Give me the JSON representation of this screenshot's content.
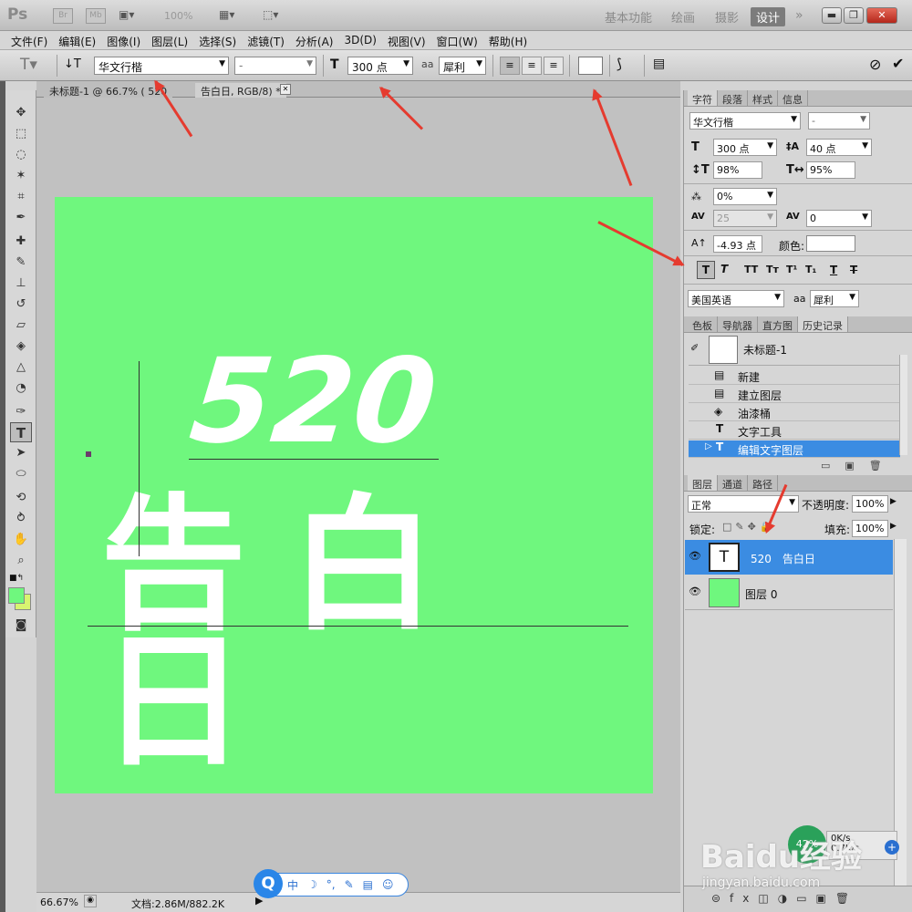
{
  "app": {
    "logo": "Ps",
    "mini_br": "Br",
    "mini_mb": "Mb",
    "zoom_pct": "100%",
    "workspaces": [
      "基本功能",
      "绘画",
      "摄影",
      "设计"
    ],
    "more": "»"
  },
  "menu": [
    "文件(F)",
    "编辑(E)",
    "图像(I)",
    "图层(L)",
    "选择(S)",
    "滤镜(T)",
    "分析(A)",
    "3D(D)",
    "视图(V)",
    "窗口(W)",
    "帮助(H)"
  ],
  "options": {
    "font_family": "华文行楷",
    "font_style": "-",
    "font_size": "300 点",
    "aa_label": "a",
    "aa_mode": "犀利"
  },
  "doc": {
    "tab1": "未标题-1 @ 66.7% ( 520",
    "tab2": "告白日, RGB/8) *",
    "close": "✕"
  },
  "canvas": {
    "line1": "520",
    "line2": "告白日",
    "bg": "#6ff77e"
  },
  "status": {
    "zoom": "66.67%",
    "doc_info": "文档:2.86M/882.2K"
  },
  "ime": {
    "items": [
      "中",
      "☽",
      "°,",
      "✎",
      "▤",
      "☺"
    ]
  },
  "char_panel": {
    "tabs": [
      "字符",
      "段落",
      "样式",
      "信息"
    ],
    "font_family": "华文行楷",
    "font_style": "-",
    "size": "300 点",
    "leading": "40 点",
    "vscale": "98%",
    "hscale": "95%",
    "tsume": "0%",
    "kerning": "25",
    "tracking": "0",
    "baseline": "-4.93 点",
    "color_label": "颜色:",
    "language": "美国英语",
    "aa_label": "a",
    "aa_mode": "犀利"
  },
  "hist_panel": {
    "tabs": [
      "色板",
      "导航器",
      "直方图",
      "历史记录"
    ],
    "snapshot": "未标题-1",
    "items": [
      "新建",
      "建立图层",
      "油漆桶",
      "文字工具",
      "编辑文字图层"
    ]
  },
  "layers_panel": {
    "tabs": [
      "图层",
      "通道",
      "路径"
    ],
    "blend": "正常",
    "opacity_label": "不透明度:",
    "opacity": "100%",
    "lock_label": "锁定:",
    "fill_label": "填充:",
    "fill": "100%",
    "layers": [
      {
        "name": "520　告白日",
        "thumb": "T"
      },
      {
        "name": "图层 0"
      }
    ]
  },
  "netspeed": {
    "pct": "42%",
    "up": "0K/s",
    "down": "0.7K/s"
  },
  "watermark": {
    "text": "Baidu经验",
    "url": "jingyan.baidu.com"
  }
}
